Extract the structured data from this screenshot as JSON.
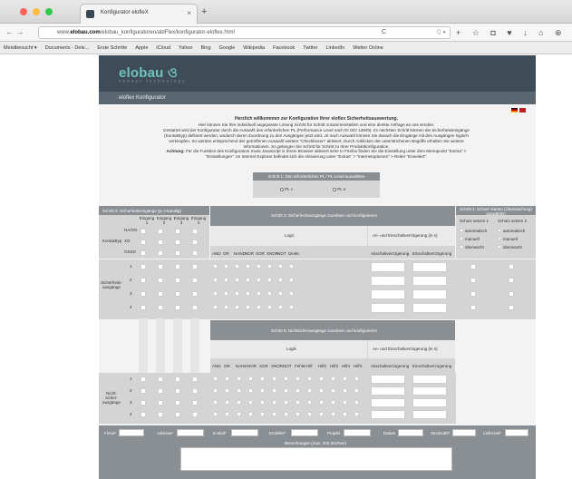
{
  "browser": {
    "tab_title": "Konfigurator elofleX",
    "tab_close": "×",
    "new_tab": "+",
    "nav_buttons": "← →",
    "url_prefix": "www.",
    "url_domain": "elobau.com",
    "url_rest": "/elobau_konfiguratoren/ablFlex/konfigurator-eloflex.html",
    "reload": "C",
    "search_hint": "Q ●",
    "toolbar_icons": "+ ☆ ◘ ♥ ↓ ⌂ ⊕",
    "bookmarks": [
      "Meistbesucht ▾",
      "Documents - Dele...",
      "Erste Schritte",
      "Apple",
      "iCloud",
      "Yahoo",
      "Bing",
      "Google",
      "Wikipedia",
      "Facebook",
      "Twitter",
      "LinkedIn",
      "Wetter Online"
    ]
  },
  "site": {
    "logo": "elobau ও",
    "logo_sub": "sensor technology",
    "subbar_title": "eloflex Konfigurator"
  },
  "intro": {
    "heading": "Herzlich willkommen zur Konfiguration Ihrer eloflex Sicherheitsauswertung.",
    "line1": "Hier können Sie Ihre individuell angepasste Lösung Schritt für Schritt zusammenstellen und eine direkte Anfrage an uns senden.",
    "line2": "Gestartet wird der Konfigurator durch die Auswahl des erforderlichen PL (Performance Level nach DI ISO 13849). Im nächsten Schritt können die Sicherheitseingänge",
    "line3": "(Kontakttyp) definiert werden, wodurch deren Zuordnung zu den Ausgängen jetzt wird. Je nach Auswahl können Sie danach die Eingänge mit den Ausgängen logisch",
    "line4": "verknüpfen. So werden entsprechend der getroffenen Auswahl weitere \"Checkboxen\" aktiviert. Durch Anklicken der unterstrichenen Begriffe erhalten Sie weitere",
    "line5": "Informationen. So gelangen Sie Schritt für Schritt zu Ihrer Produktkonfiguration.",
    "attention_label": "Achtung:",
    "attention_text": "Für die Funktion des Konfigurators muss Javascript in Ihrem Browser aktiviert sein! In Firefox finden Sie die Einstellung unter dem Menüpunkt \"Extras\" >",
    "attention_text2": "\"Einstellungen\". Im Internet Explorer befindet sich die Aktivierung unter \"Extras\" > \"Internetoptionen\" > Reiter \"Erweitert\"."
  },
  "step1": {
    "heading": "Schritt 1: Den erforderlichen PL / PL-Level auswählen",
    "option_a": "PL c",
    "option_b": "PL e"
  },
  "step2": {
    "heading": "Schritt 2: Sicherheitseingänge (je 2-kanalig)",
    "inputs": [
      "Eingang 1",
      "Eingang 2",
      "Eingang 3",
      "Eingang 4"
    ],
    "kontakttyp_label": "Kontakttyp",
    "kontakt_rows": [
      "NA/OO",
      "XO",
      "OSSD"
    ],
    "output_label": "Sicherheits-ausgänge",
    "output_rows": [
      "1",
      "2",
      "3",
      "4"
    ]
  },
  "step3": {
    "heading": "Schritt 3: Sicherheitsausgänge zuordnen und konfigurieren",
    "logic_label": "Logic",
    "delay_label": "An- und Einschaltverzögerung (in s)",
    "logic_cols": [
      "AND",
      "OR",
      "NAND",
      "NOR",
      "XOR",
      "XNOR",
      "NOT",
      "Direkt"
    ],
    "delay_cols": [
      "Abschaltverzögerung",
      "Einschaltverzögerung"
    ]
  },
  "step4": {
    "heading": "Schritt 4: Schutz starten (Überwachung) auswählen",
    "col1": "Schutz setzen 1",
    "col2": "Schutz setzen 2",
    "options": [
      "automatisch",
      "manuell",
      "überwacht"
    ]
  },
  "step5": {
    "heading": "Schritt 5: Nichtsicherausgänge zuordnen und konfigurieren",
    "logic_label": "Logik",
    "delay_label": "An- und Einschaltverzögerung (in s)",
    "logic_cols": [
      "AND",
      "OR",
      "NAND",
      "NOR",
      "XOR",
      "XNOR",
      "NOT",
      "Fehler",
      "Hilf",
      "Hilf2",
      "Hilf3",
      "Hilf4",
      "HilfX"
    ],
    "delay_cols": [
      "Abschaltverzögerung",
      "Einschaltverzögerung"
    ],
    "output_label": "Nicht-sicher-ausgänge",
    "output_rows": [
      "1",
      "2",
      "3",
      "4"
    ]
  },
  "footer": {
    "firma": "Firma*",
    "adresse": "Adresse*",
    "email": "E-Mail*",
    "ersteller": "Ersteller*",
    "projekt": "Projekt",
    "datum": "Datum",
    "stueckzahl": "Stückzahl*",
    "lieferzeit": "Lieferzeit*",
    "comment_label": "Bemerkungen (max. 200 Zeichen)"
  },
  "colors": {
    "header": "#3d4c57",
    "subbar": "#5a6770",
    "accent": "#73c0be",
    "panel": "#8a8f94",
    "cell": "#d4d4d4"
  }
}
